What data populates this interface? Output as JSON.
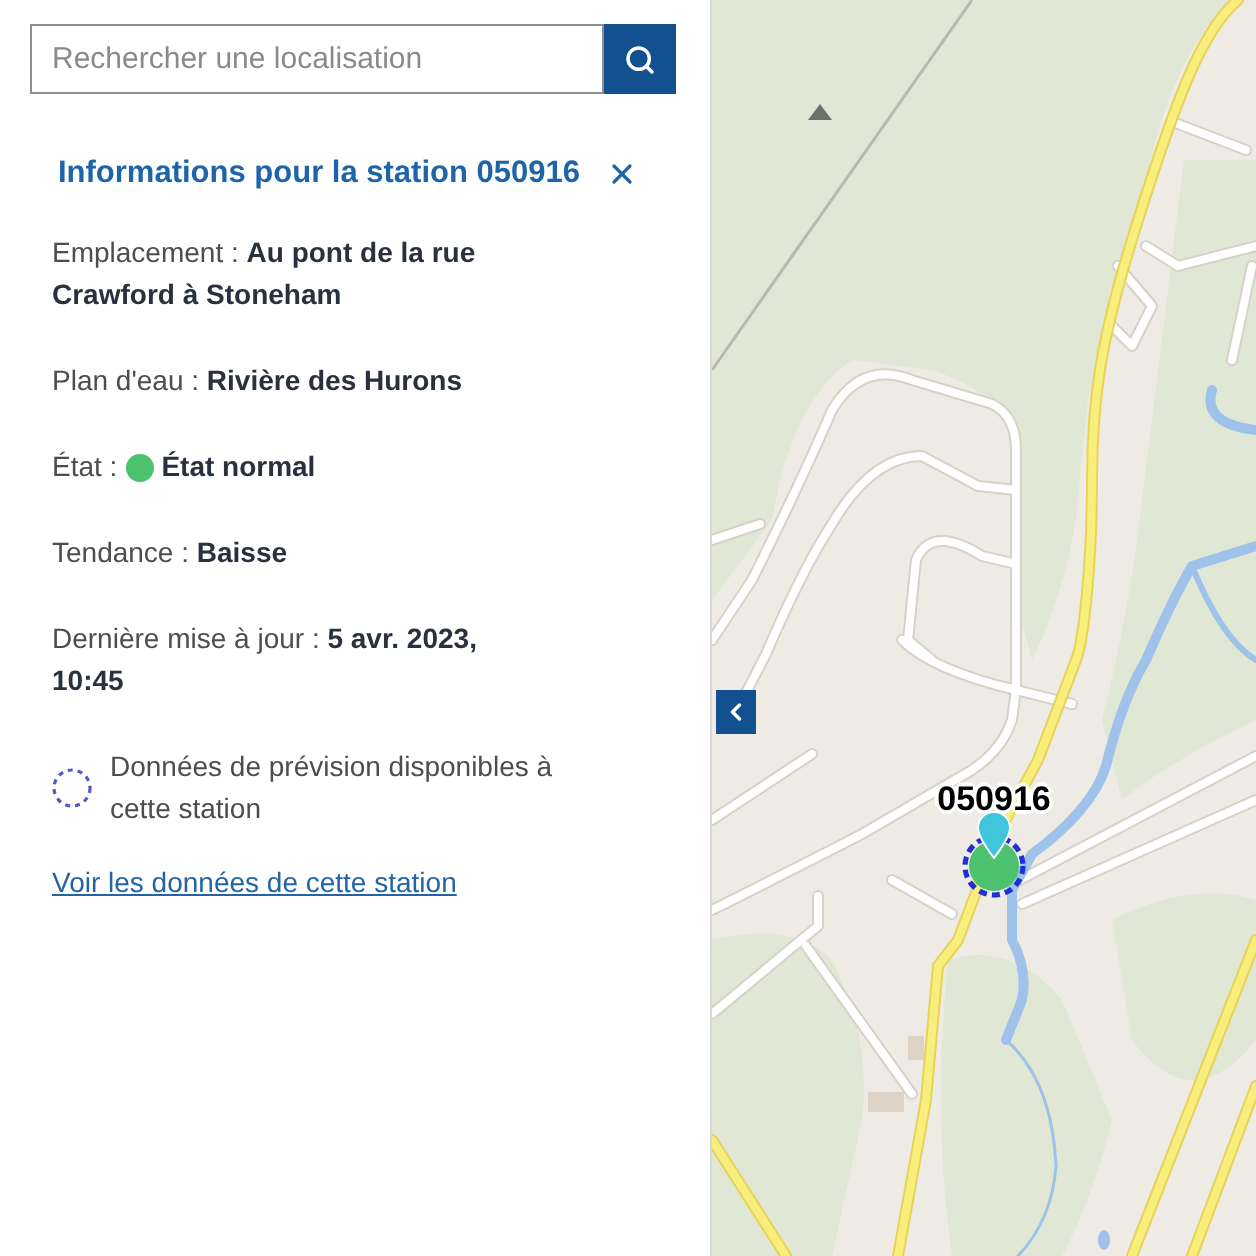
{
  "search": {
    "placeholder": "Rechercher une localisation"
  },
  "panel": {
    "title": "Informations pour la station 050916",
    "fields": [
      {
        "kind": "text",
        "label": "Emplacement :",
        "value": "Au pont de la rue Crawford à Stoneham"
      },
      {
        "kind": "text",
        "label": "Plan d'eau :",
        "value": "Rivière des Hurons"
      },
      {
        "kind": "status",
        "label": "État :",
        "value": "État normal",
        "color": "#4cc26e"
      },
      {
        "kind": "text",
        "label": "Tendance :",
        "value": "Baisse"
      },
      {
        "kind": "text",
        "label": "Dernière mise à jour :",
        "value": "5 avr. 2023, 10:45"
      }
    ],
    "forecast_note": "Données de prévision disponibles à cette station",
    "link": "Voir les données de cette station"
  },
  "map": {
    "station_label": "050916"
  }
}
